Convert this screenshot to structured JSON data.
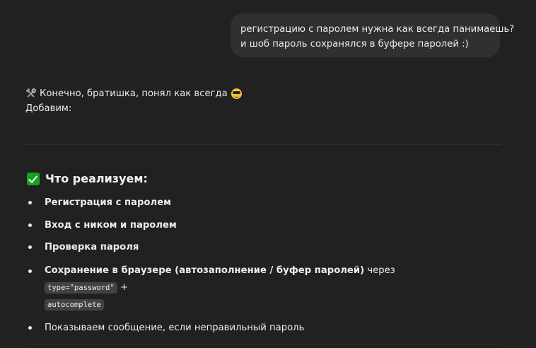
{
  "user_message": {
    "line1": "регистрацию с паролем нужна как всегда панимаешь?",
    "line2": "и шоб пароль сохранялся в буфере паролей :)"
  },
  "assistant": {
    "intro": "Конечно, братишка, понял как всегда",
    "intro_emoji_before": "hammer-and-wrench-icon",
    "intro_emoji_after": "smiling-face-with-sunglasses-icon",
    "subline": "Добавим:",
    "section_title": "Что реализуем:",
    "section_icon": "check-mark-button-icon",
    "features": [
      {
        "text": "Регистрация с паролем"
      },
      {
        "text": "Вход с ником и паролем"
      },
      {
        "text": "Проверка пароля"
      },
      {
        "text": "Сохранение в браузере (автозаполнение / буфер паролей)",
        "connector": "через",
        "code1": "type=\"password\"",
        "plus": "+",
        "code2": "autocomplete"
      },
      {
        "text": "Показываем сообщение, если неправильный пароль"
      }
    ]
  },
  "colors": {
    "background": "#212121",
    "user_bubble": "#303030",
    "text": "#ececec",
    "check_green": "#15a31f",
    "code_bg": "#424242"
  }
}
